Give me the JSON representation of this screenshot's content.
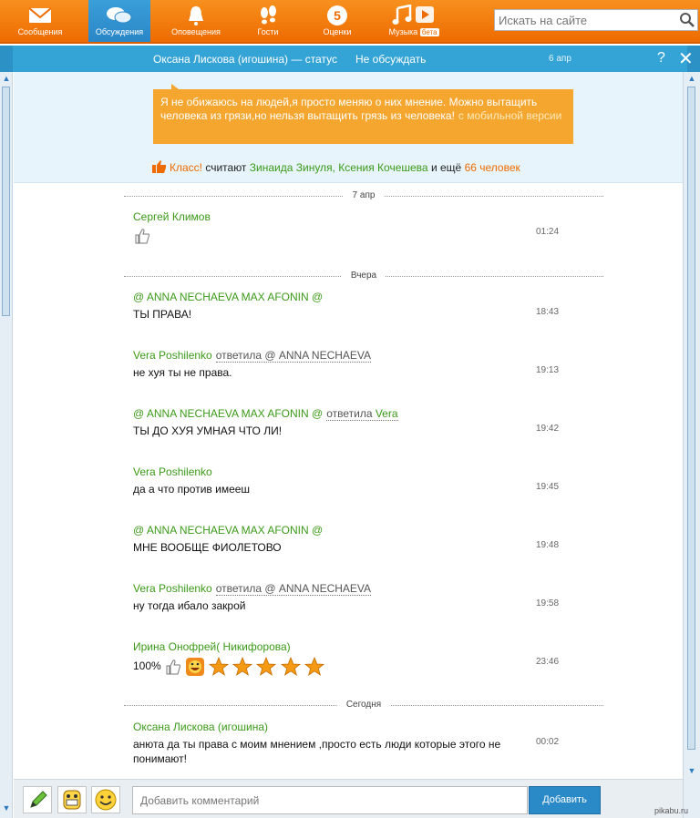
{
  "nav": {
    "items": [
      {
        "label": "Сообщения",
        "icon": "envelope-icon"
      },
      {
        "label": "Обсуждения",
        "icon": "chat-bubbles-icon",
        "active": true
      },
      {
        "label": "Оповещения",
        "icon": "bell-icon"
      },
      {
        "label": "Гости",
        "icon": "footprints-icon"
      },
      {
        "label": "Оценки",
        "icon": "rating-five-icon",
        "badge": "5"
      },
      {
        "label": "Музыка",
        "icon": "music-note-icon",
        "beta": "бета"
      }
    ],
    "search_placeholder": "Искать на сайте"
  },
  "header": {
    "title": "Оксана Лискова (игошина) — статус",
    "unfollow": "Не обсуждать",
    "date": "6 апр",
    "help": "?",
    "close": "✕"
  },
  "status": {
    "text": "Я не обижаюсь на людей,я просто меняю о них мнение. Можно вытащить человека из грязи,но нельзя вытащить грязь из человека!",
    "mobile_link": "с мобильной версии"
  },
  "likes": {
    "klass": "Класс!",
    "consider": "считают",
    "names": "Зинаида Зинуля, Ксения Кочешева",
    "and_more": "и ещё",
    "count": "66 человек"
  },
  "days": [
    {
      "label": "7 апр"
    },
    {
      "label": "Вчера"
    },
    {
      "label": "Сегодня"
    }
  ],
  "comments": [
    {
      "author": "Сергей Климов",
      "reply_word": "",
      "reply_to": "",
      "text": "",
      "time": "01:24"
    },
    {
      "author": "@ ANNA NECHAEVA MAX AFONIN @",
      "reply_word": "",
      "reply_to": "",
      "text": "ТЫ ПРАВА!",
      "time": "18:43"
    },
    {
      "author": "Vera Poshilenko",
      "reply_word": "ответила",
      "reply_to": "@ ANNA NECHAEVA",
      "text": "не хуя ты не права.",
      "time": "19:13"
    },
    {
      "author": "@ ANNA NECHAEVA MAX AFONIN @",
      "reply_word": "ответила",
      "reply_to": "Vera",
      "text": "ТЫ ДО ХУЯ УМНАЯ ЧТО ЛИ!",
      "time": "19:42"
    },
    {
      "author": "Vera Poshilenko",
      "reply_word": "",
      "reply_to": "",
      "text": "да а что против  имееш",
      "time": "19:45"
    },
    {
      "author": "@ ANNA NECHAEVA MAX AFONIN @",
      "reply_word": "",
      "reply_to": "",
      "text": "МНЕ ВООБЩЕ ФИОЛЕТОВО",
      "time": "19:48"
    },
    {
      "author": "Vera Poshilenko",
      "reply_word": "ответила",
      "reply_to": "@ ANNA NECHAEVA",
      "text": "ну тогда ибало закрой",
      "time": "19:58"
    },
    {
      "author": "Ирина Онофрей( Никифорова)",
      "reply_word": "",
      "reply_to": "",
      "text": "100%",
      "time": "23:46"
    },
    {
      "author": "Оксана Лискова (игошина)",
      "reply_word": "",
      "reply_to": "",
      "text": "анюта да ты права с моим мнением ,просто есть люди которые этого не понимают!",
      "time": "00:02"
    }
  ],
  "composer": {
    "placeholder": "Добавить комментарий",
    "add_label": "Добавить"
  },
  "watermark": "pikabu.ru",
  "colors": {
    "nav_orange": "#ee6b00",
    "header_blue": "#34a3d6",
    "author_green": "#3c9a19",
    "bubble": "#f4a62f"
  }
}
